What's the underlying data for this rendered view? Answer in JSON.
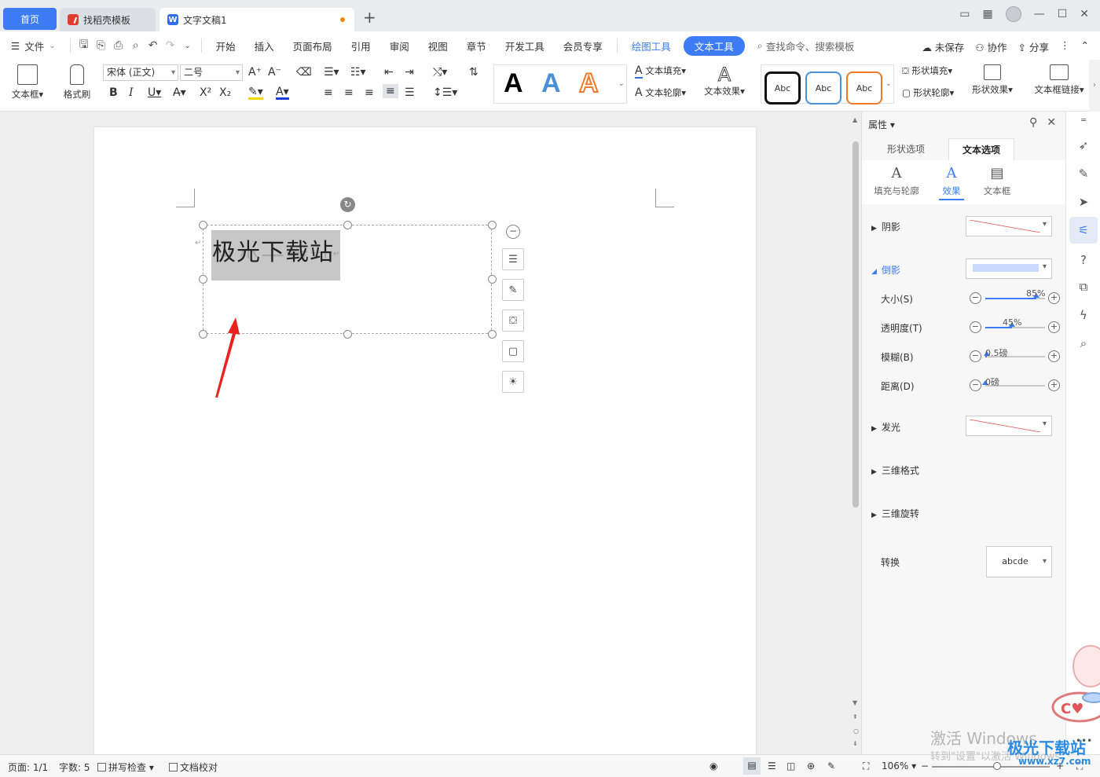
{
  "tabs": {
    "home": "首页",
    "template": "找稻壳模板",
    "document": "文字文稿1"
  },
  "menu": {
    "file": "文件",
    "items": [
      "开始",
      "插入",
      "页面布局",
      "引用",
      "审阅",
      "视图",
      "章节",
      "开发工具",
      "会员专享"
    ],
    "drawing_tools": "绘图工具",
    "text_tools": "文本工具",
    "search_placeholder": "查找命令、搜索模板",
    "unsaved": "未保存",
    "collaborate": "协作",
    "share": "分享"
  },
  "ribbon": {
    "textbox_label": "文本框",
    "format_painter_label": "格式刷",
    "font_name": "宋体 (正文)",
    "font_size": "二号",
    "wordart_letter": "A",
    "text_fill": "文本填充",
    "text_outline": "文本轮廓",
    "text_effect": "文本效果",
    "shape_style_label": "Abc",
    "shape_fill": "形状填充",
    "shape_outline": "形状轮廓",
    "shape_effect": "形状效果",
    "textbox_link": "文本框链接"
  },
  "document": {
    "text": "极光下载站"
  },
  "panel": {
    "title": "属性",
    "tab_shape": "形状选项",
    "tab_text": "文本选项",
    "sub_fill": "填充与轮廓",
    "sub_effect": "效果",
    "sub_textbox": "文本框",
    "shadow": "阴影",
    "reflection": "倒影",
    "size_label": "大小(S)",
    "size_value": "85%",
    "size_fraction": 0.85,
    "transparency_label": "透明度(T)",
    "transparency_value": "45%",
    "transparency_fraction": 0.45,
    "blur_label": "模糊(B)",
    "blur_value": "0.5磅",
    "blur_fraction": 0.02,
    "distance_label": "距离(D)",
    "distance_value": "0磅",
    "distance_fraction": 0,
    "glow": "发光",
    "three_d_format": "三维格式",
    "three_d_rotation": "三维旋转",
    "transform": "转换",
    "transform_value": "abcde"
  },
  "status": {
    "page": "页面: 1/1",
    "word_count": "字数: 5",
    "spell_check": "拼写检查",
    "doc_proof": "文档校对",
    "zoom": "106%"
  },
  "watermark": {
    "line1": "激活 Windows",
    "line2": "转到\"设置\"以激活 Windows。",
    "logo": "极光下载站",
    "logo_url": "www.xz7.com"
  },
  "colors": {
    "accent": "#3d7cf5",
    "red_line": "#e03a3a",
    "wordart_blue": "#4a90d9",
    "wordart_orange": "#f07a28"
  }
}
